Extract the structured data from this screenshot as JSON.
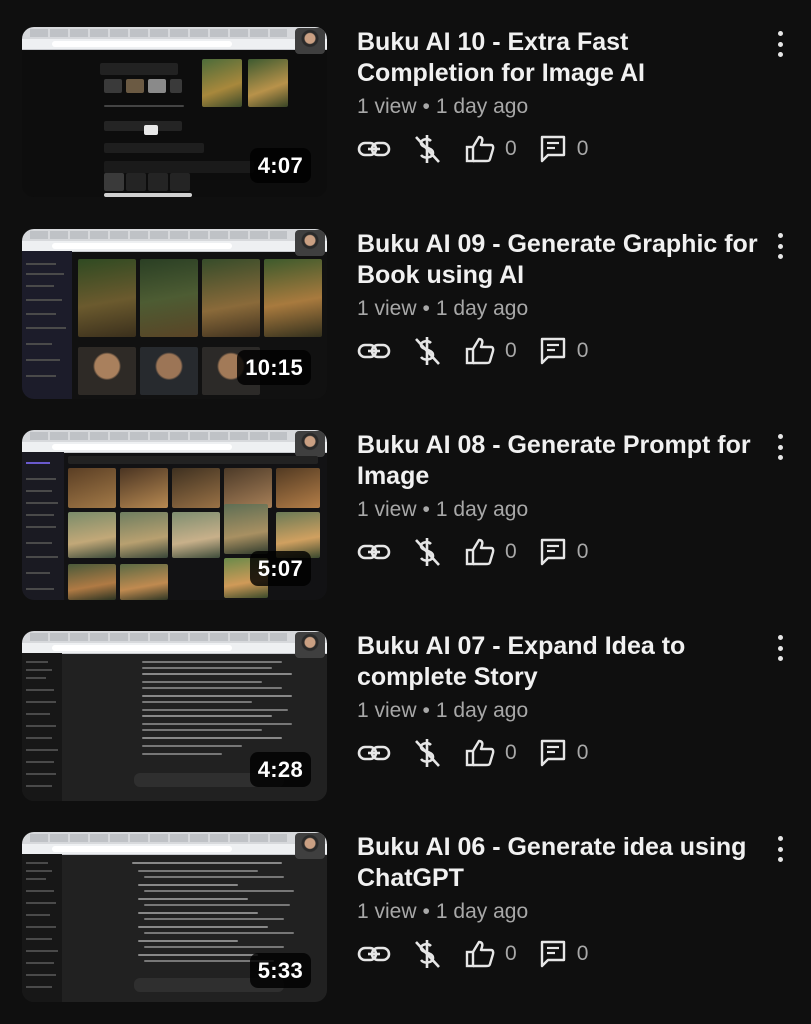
{
  "videos": [
    {
      "title": "Buku AI 10 - Extra Fast Completion for Image AI",
      "views": "1 view",
      "age": "1 day ago",
      "duration": "4:07",
      "likes": "0",
      "comments": "0"
    },
    {
      "title": "Buku AI 09 - Generate Graphic for Book using AI",
      "views": "1 view",
      "age": "1 day ago",
      "duration": "10:15",
      "likes": "0",
      "comments": "0"
    },
    {
      "title": "Buku AI 08 - Generate Prompt for Image",
      "views": "1 view",
      "age": "1 day ago",
      "duration": "5:07",
      "likes": "0",
      "comments": "0"
    },
    {
      "title": "Buku AI 07 - Expand Idea to complete Story",
      "views": "1 view",
      "age": "1 day ago",
      "duration": "4:28",
      "likes": "0",
      "comments": "0"
    },
    {
      "title": "Buku AI 06 - Generate idea using ChatGPT",
      "views": "1 view",
      "age": "1 day ago",
      "duration": "5:33",
      "likes": "0",
      "comments": "0"
    }
  ],
  "separator": "•",
  "icons": {
    "share": "link-icon",
    "monetization": "monetization-off-icon",
    "like": "thumb-up-icon",
    "comment": "comment-icon",
    "more": "more-vert-icon"
  },
  "colors": {
    "background": "#0f0f0f",
    "text": "#f1f1f1",
    "secondary": "#a8a8a8"
  }
}
